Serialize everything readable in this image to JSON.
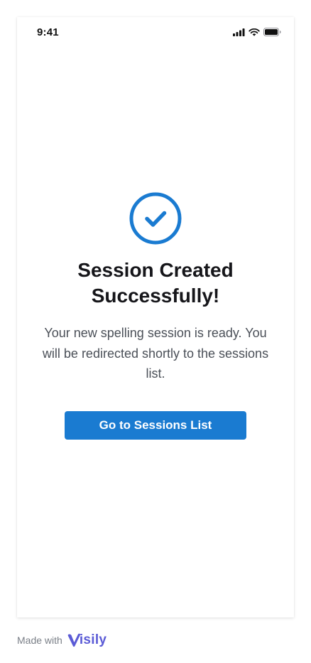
{
  "status_bar": {
    "time": "9:41",
    "icons": [
      "cellular-signal-icon",
      "wifi-icon",
      "battery-icon"
    ]
  },
  "confirmation": {
    "icon": "check-circle-icon",
    "title": "Session Created Successfully!",
    "message": "Your new spelling session is ready. You will be redirected shortly to the sessions list.",
    "button_label": "Go to Sessions List"
  },
  "footer": {
    "made_with": "Made with",
    "brand": "isily",
    "brand_icon": "visily-logo-icon"
  },
  "colors": {
    "accent": "#1a7bd1",
    "title_text": "#16161a",
    "body_text": "#4b5058",
    "brand": "#5b5bd6"
  }
}
